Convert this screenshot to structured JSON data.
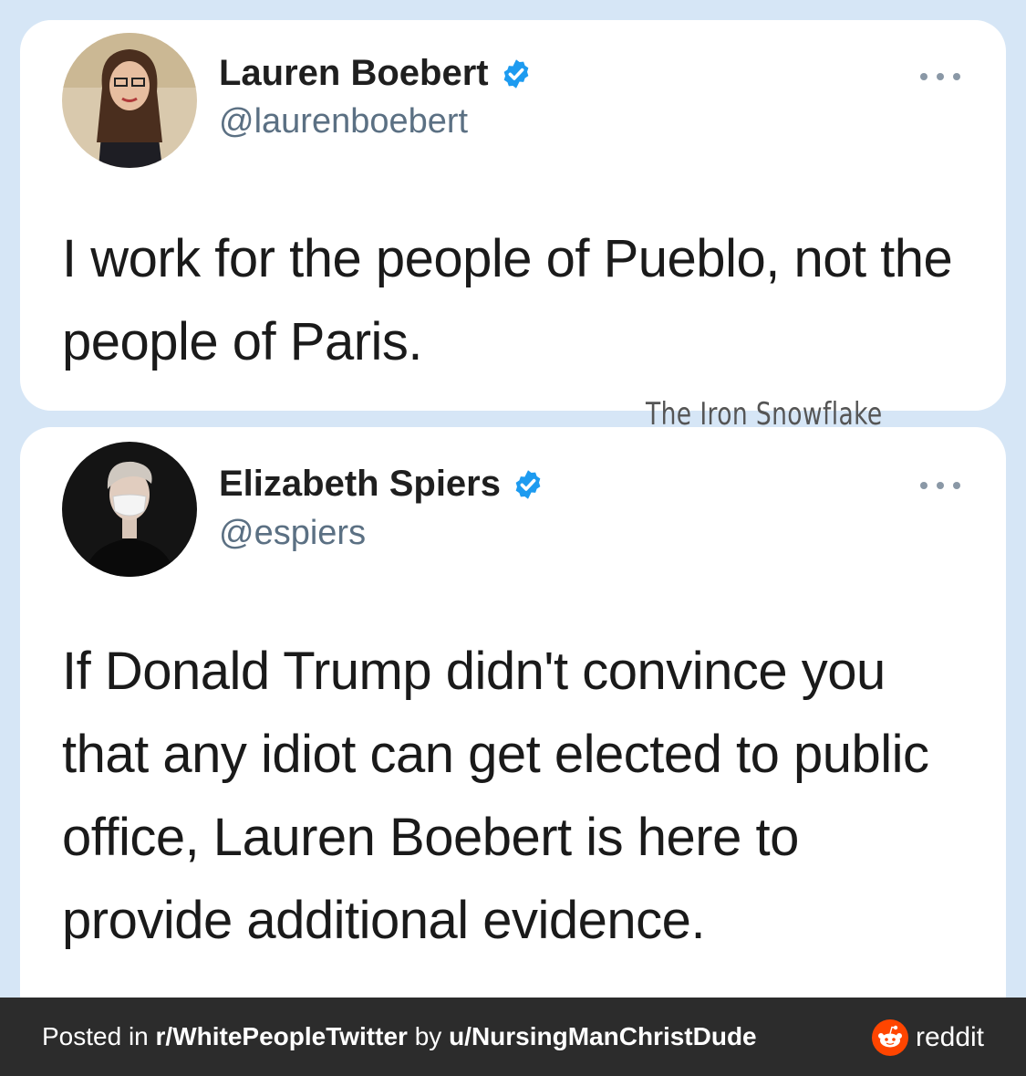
{
  "tweets": [
    {
      "name": "Lauren Boebert",
      "handle": "@laurenboebert",
      "text": "I work for the people of Pueblo, not the people of Paris.",
      "avatar_icon": "profile-photo"
    },
    {
      "name": "Elizabeth Spiers",
      "handle": "@espiers",
      "text": "If Donald Trump didn't convince you that any idiot can get elected to public office, Lauren Boebert is here to provide additional evidence.",
      "avatar_icon": "profile-photo"
    }
  ],
  "watermark": "The Iron Snowflake",
  "footer": {
    "posted_in": "Posted in ",
    "subreddit": "r/WhitePeopleTwitter",
    "by": " by ",
    "user": "u/NursingManChristDude",
    "brand": "reddit"
  },
  "colors": {
    "background": "#d6e6f6",
    "verified": "#1d9bf0",
    "footer": "#2c2c2c",
    "reddit_orange": "#ff4500"
  }
}
